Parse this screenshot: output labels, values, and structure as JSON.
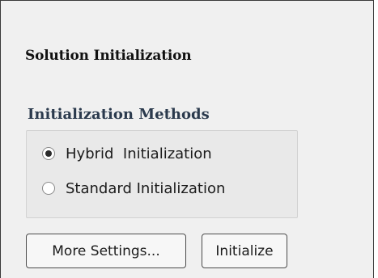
{
  "panel": {
    "title": "Solution Initialization"
  },
  "initialization_methods": {
    "label": "Initialization Methods",
    "options": [
      {
        "label": "Hybrid  Initialization",
        "selected": true
      },
      {
        "label": "Standard Initialization",
        "selected": false
      }
    ]
  },
  "buttons": {
    "more_settings": "More Settings...",
    "initialize": "Initialize"
  }
}
